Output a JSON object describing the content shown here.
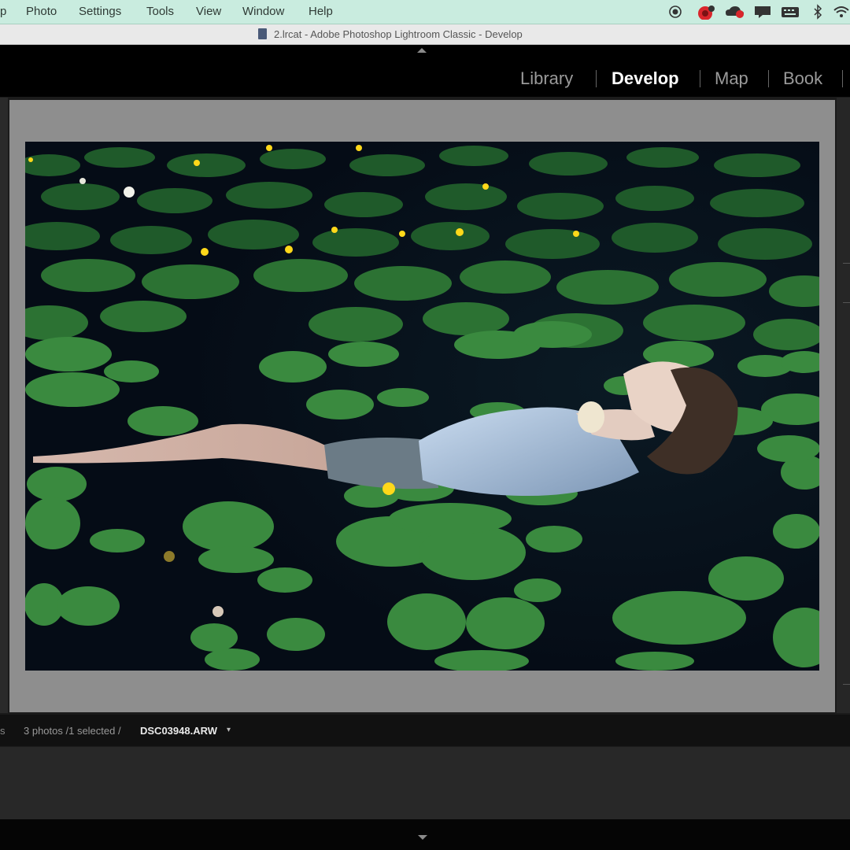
{
  "menubar": {
    "items": [
      "p",
      "Photo",
      "Settings",
      "Tools",
      "View",
      "Window",
      "Help"
    ],
    "tray_icons": [
      "record-icon",
      "notification-badge-icon",
      "cloud-sync-icon",
      "chat-icon",
      "keyboard-icon",
      "bluetooth-icon",
      "wifi-icon"
    ],
    "badge_color": "#d9262c"
  },
  "window": {
    "title": "2.lrcat - Adobe Photoshop Lightroom Classic - Develop",
    "doc_icon": "document-icon"
  },
  "modules": [
    {
      "label": "Library",
      "active": false
    },
    {
      "label": "Develop",
      "active": true
    },
    {
      "label": "Map",
      "active": false
    },
    {
      "label": "Book",
      "active": false
    }
  ],
  "photo": {
    "subject": "lily-pad-pond-portrait",
    "colors": {
      "water": "#06101d",
      "pad": "#2f7a35",
      "pad_light": "#3f9444",
      "flower": "#ffd81a",
      "shirt": "#b9cfe6",
      "skin": "#e6cfc2"
    }
  },
  "filmstrip": {
    "left_text": "s",
    "count_text": "3 photos /1 selected /",
    "filename": "DSC03948.ARW",
    "dropdown_caret": "▾"
  },
  "colors": {
    "menubar_bg": "#c9ecdf",
    "canvas_bg": "#8e8e8e",
    "topbar_bg": "#000000",
    "active_module": "#ffffff",
    "inactive_module": "#9a9a9a"
  }
}
